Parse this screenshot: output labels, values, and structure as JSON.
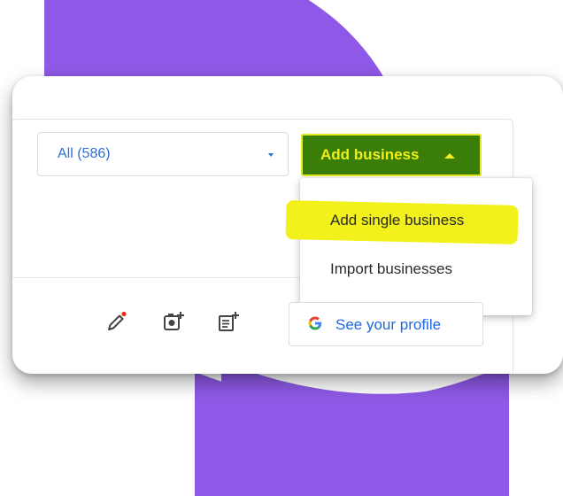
{
  "filter": {
    "label": "All (586)"
  },
  "add_business": {
    "label": "Add business"
  },
  "menu": {
    "items": [
      {
        "label": "Add single business"
      },
      {
        "label": "Import businesses"
      }
    ]
  },
  "toolbar": {
    "icons": [
      "edit-icon",
      "add-photo-icon",
      "add-post-icon"
    ]
  },
  "profile_button": {
    "label": "See your profile",
    "icon": "google-g-icon"
  },
  "colors": {
    "purple": "#8e59e6",
    "button_green": "#3a7e08",
    "highlight_yellow": "#f2f11b",
    "link_blue": "#1f67e0"
  }
}
